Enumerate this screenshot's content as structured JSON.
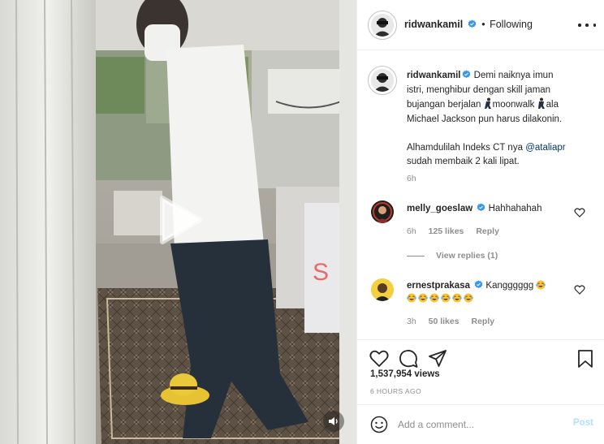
{
  "post": {
    "author": "ridwankamil",
    "separator": "•",
    "follow_status": "Following",
    "more_icon": "more-options-icon",
    "caption_lines": [
      "Demi naiknya imun",
      "istri, menghibur dengan skill jaman",
      "bujangan berjalan",
      "moonwalk",
      "ala",
      "Michael Jackson pun harus dilakonin.",
      "Alhamdulilah Indeks CT nya",
      "@ataliapr",
      "sudah membaik 2 kali lipat."
    ],
    "caption_time": "6h"
  },
  "comments": [
    {
      "user": "melly_goeslaw",
      "text": "Hahhahahah",
      "time": "6h",
      "likes": "125 likes",
      "reply": "Reply",
      "view_replies": "View replies (1)"
    },
    {
      "user": "ernestprakasa",
      "text": "Kangggggg",
      "emoji_count": 6,
      "emoji_name": "tears-of-joy-emoji",
      "time": "3h",
      "likes": "50 likes",
      "reply": "Reply"
    }
  ],
  "actions": {
    "icons": [
      "heart-icon",
      "comment-icon",
      "share-icon",
      "bookmark-icon"
    ],
    "views": "1,537,954 views",
    "posted": "6 HOURS AGO"
  },
  "composer": {
    "placeholder": "Add a comment...",
    "post_label": "Post"
  },
  "video": {
    "play_icon": "play-icon",
    "volume_icon": "volume-icon"
  },
  "colors": {
    "link": "#00376b",
    "verified": "#3897f0",
    "post_disabled": "#b2dffc",
    "muted": "#8e8e8e"
  }
}
